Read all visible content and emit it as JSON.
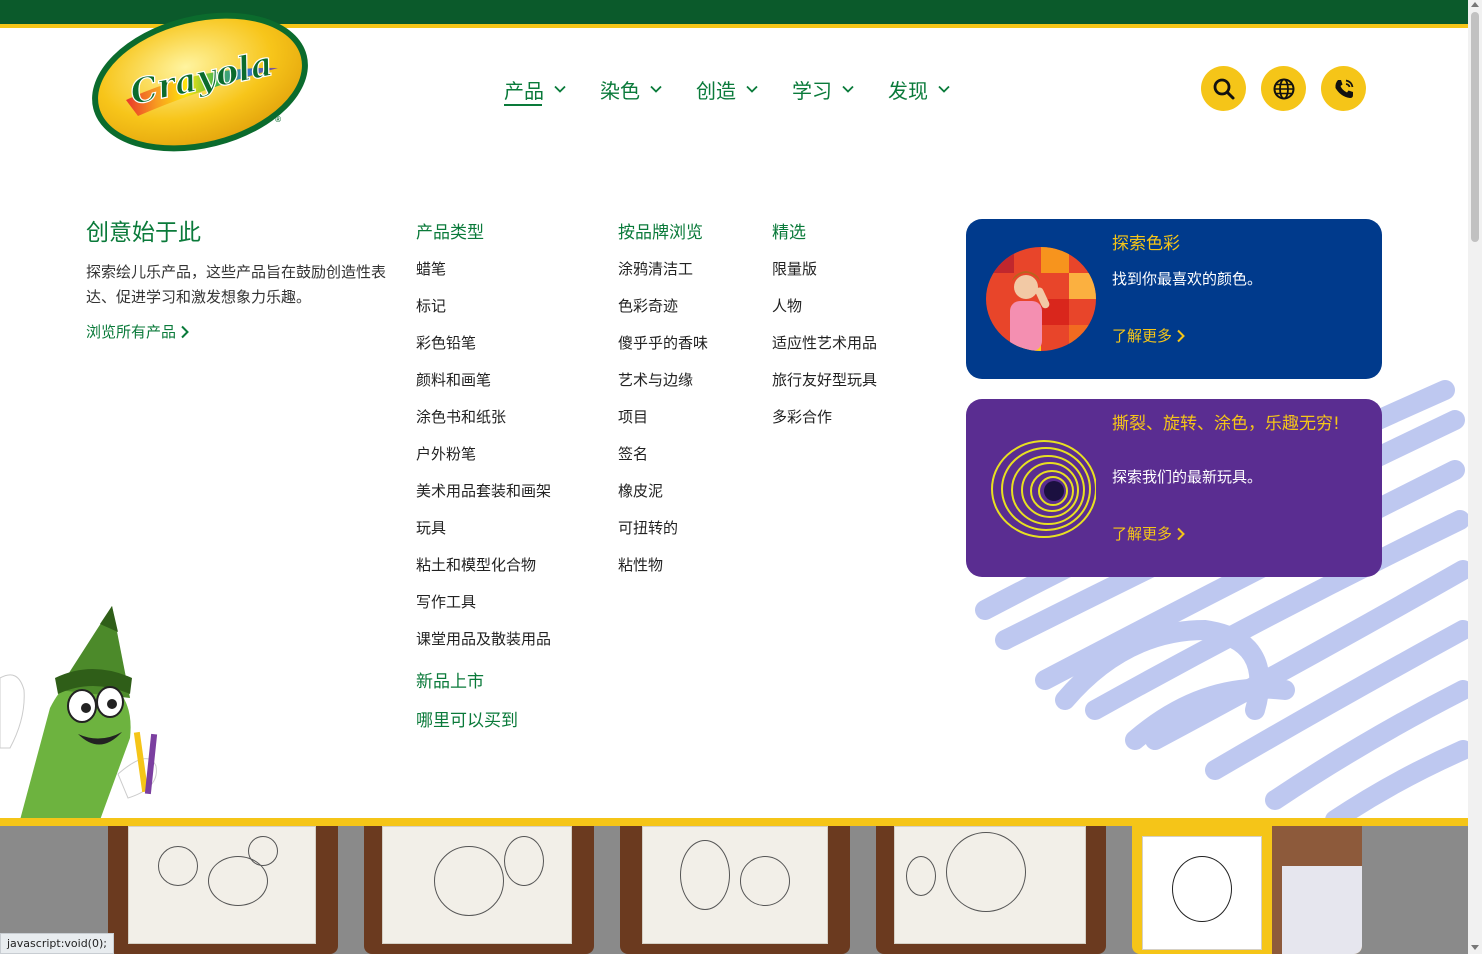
{
  "brand": {
    "logo_text": "Crayola",
    "green": "#0a7a3a",
    "yellow": "#f5c518",
    "dark_green": "#0b5a2b"
  },
  "nav": {
    "items": [
      {
        "label": "产品",
        "active": true
      },
      {
        "label": "染色"
      },
      {
        "label": "创造"
      },
      {
        "label": "学习"
      },
      {
        "label": "发现"
      }
    ],
    "icons": [
      "search-icon",
      "globe-icon",
      "phone-icon"
    ]
  },
  "mega": {
    "intro": {
      "title": "创意始于此",
      "text": "探索绘儿乐产品，这些产品旨在鼓励创造性表达、促进学习和激发想象力乐趣。",
      "link": "浏览所有产品"
    },
    "columns": [
      {
        "heading": "产品类型",
        "items": [
          "蜡笔",
          "标记",
          "彩色铅笔",
          "颜料和画笔",
          "涂色书和纸张",
          "户外粉笔",
          "美术用品套装和画架",
          "玩具",
          "粘土和模型化合物",
          "写作工具",
          "课堂用品及散装用品"
        ],
        "extras": [
          "新品上市",
          "哪里可以买到"
        ]
      },
      {
        "heading": "按品牌浏览",
        "items": [
          "涂鸦清洁工",
          "色彩奇迹",
          "傻乎乎的香味",
          "艺术与边缘",
          "项目",
          "签名",
          "橡皮泥",
          "可扭转的",
          "粘性物"
        ]
      },
      {
        "heading": "精选",
        "items": [
          "限量版",
          "人物",
          "适应性艺术用品",
          "旅行友好型玩具",
          "多彩合作"
        ]
      }
    ],
    "cards": [
      {
        "title": "探索色彩",
        "text": "找到你最喜欢的颜色。",
        "link": "了解更多"
      },
      {
        "title": "撕裂、旋转、涂色，乐趣无穷!",
        "text": "探索我们的最新玩具。",
        "link": "了解更多"
      }
    ]
  },
  "status": {
    "url": "javascript:void(0);"
  }
}
